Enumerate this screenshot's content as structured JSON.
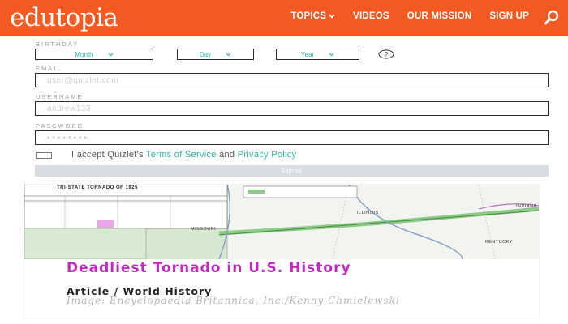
{
  "header": {
    "logo": "edutopia",
    "nav": [
      {
        "label": "TOPICS"
      },
      {
        "label": "VIDEOS"
      },
      {
        "label": "OUR MISSION"
      },
      {
        "label": "SIGN UP"
      }
    ],
    "search_icon": "search-icon",
    "bg_color": "#f15a22"
  },
  "form": {
    "birthday": {
      "label": "BIRTHDAY",
      "month": "Month",
      "day": "Day",
      "year": "Year",
      "help_icon": "help-icon"
    },
    "email": {
      "label": "EMAIL",
      "placeholder": "user@quizlet.com"
    },
    "username": {
      "label": "USERNAME",
      "placeholder": "andrew123"
    },
    "password": {
      "label": "PASSWORD",
      "placeholder": "••••••••"
    },
    "terms": {
      "prefix": "I accept Quizlet's",
      "terms_link": "Terms of Service",
      "and": "and",
      "privacy_link": "Privacy Policy"
    },
    "signup_button": "Sign up",
    "accent_color": "#2bb3a4"
  },
  "article": {
    "title": "Deadliest Tornado in U.S. History",
    "category": "Article / World History",
    "credit": "Image: Encyclopaedia Britannica, Inc./Kenny Chmielewski",
    "map": {
      "table_title": "TRI-STATE TORNADO OF 1925",
      "states": [
        "ILLINOIS",
        "MISSOURI",
        "INDIANA",
        "KENTUCKY"
      ]
    },
    "title_color": "#c02cbd"
  }
}
